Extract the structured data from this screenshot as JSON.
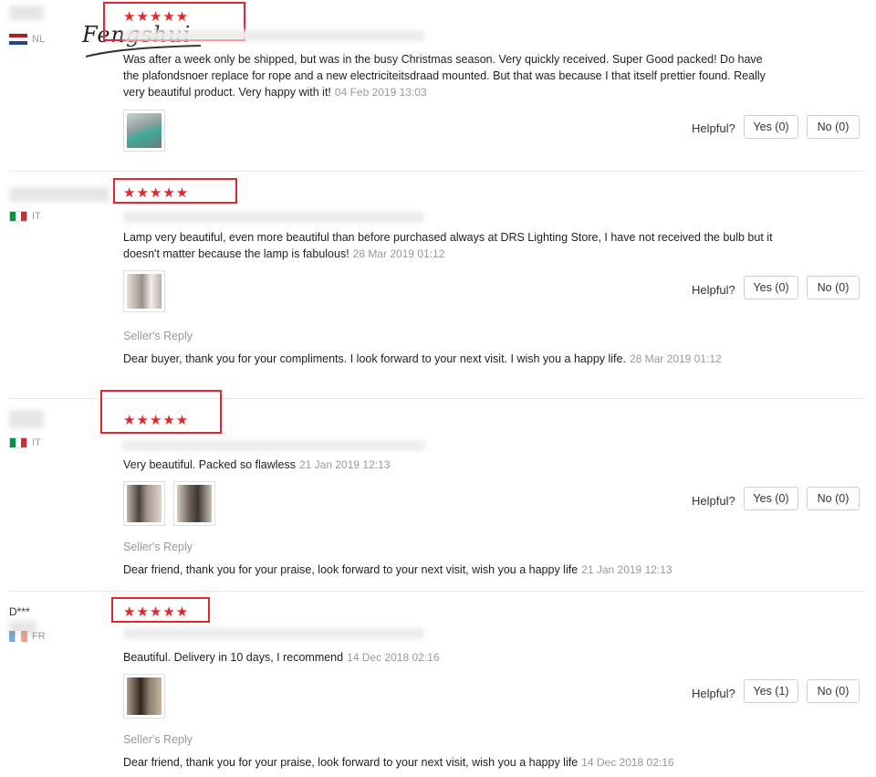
{
  "watermark": "Fengshui",
  "stars": "★★★★★",
  "helpful_label": "Helpful?",
  "seller_reply_label": "Seller's Reply",
  "reviews": [
    {
      "user": "",
      "country": "NL",
      "flag": "nl",
      "text": "Was after a week only be shipped, but was in the busy Christmas season. Very quickly received. Super Good packed! Do have the plafondsnoer replace for rope and a new electriciteitsdraad mounted. But that was because I that itself prettier found. Really very beautiful product. Very happy with it!",
      "date": "04 Feb 2019 13:03",
      "yes": "Yes (0)",
      "no": "No (0)",
      "images": [
        {
          "colors": [
            "#b8c6c2",
            "#3fa99a",
            "#7a8a86"
          ]
        }
      ],
      "seller_reply": null
    },
    {
      "user": "",
      "country": "IT",
      "flag": "it",
      "text": "Lamp very beautiful, even more beautiful than before purchased always at DRS Lighting Store, I have not received the bulb but it doesn't matter because the lamp is fabulous!",
      "date": "28 Mar 2019 01:12",
      "yes": "Yes (0)",
      "no": "No (0)",
      "images": [
        {
          "colors": [
            "#d8d2cc",
            "#8f8780",
            "#b5aba2"
          ]
        }
      ],
      "seller_reply": {
        "text": "Dear buyer, thank you for your compliments. I look forward to your next visit. I wish you a happy life.",
        "date": "28 Mar 2019 01:12"
      }
    },
    {
      "user": "",
      "country": "IT",
      "flag": "it",
      "text": "Very beautiful. Packed so flawless",
      "date": "21 Jan 2019 12:13",
      "yes": "Yes (0)",
      "no": "No (0)",
      "images": [
        {
          "colors": [
            "#a69a8e",
            "#4a423c",
            "#c9bdb1"
          ]
        },
        {
          "colors": [
            "#b8aea3",
            "#3e3731",
            "#d6cbbf"
          ]
        }
      ],
      "seller_reply": {
        "text": "Dear friend, thank you for your praise, look forward to your next visit, wish you a happy life",
        "date": "21 Jan 2019 12:13"
      }
    },
    {
      "user": "D***",
      "country": "FR",
      "flag": "fr",
      "text": "Beautiful. Delivery in 10 days, I recommend",
      "date": "14 Dec 2018 02:16",
      "yes": "Yes (1)",
      "no": "No (0)",
      "images": [
        {
          "colors": [
            "#8e7e70",
            "#2e2620",
            "#b19f8e"
          ]
        }
      ],
      "seller_reply": {
        "text": "Dear friend, thank you for your praise, look forward to your next visit, wish you a happy life",
        "date": "14 Dec 2018 02:16"
      }
    }
  ]
}
